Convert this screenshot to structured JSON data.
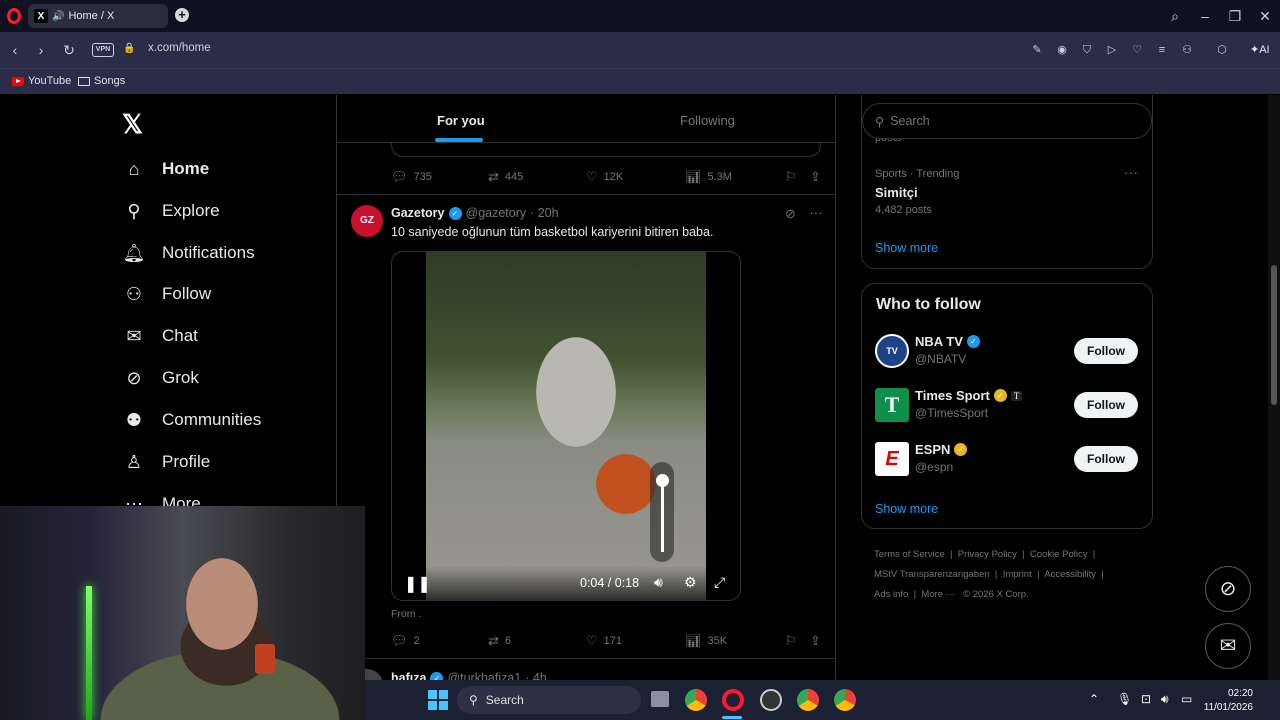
{
  "browser": {
    "tab_title": "Home / X",
    "url": "x.com/home",
    "vpn_label": "VPN",
    "ai_label": "AI",
    "bookmarks": [
      {
        "label": "YouTube",
        "icon": "youtube-icon"
      },
      {
        "label": "Songs",
        "icon": "folder-icon"
      }
    ]
  },
  "sidebar": {
    "items": [
      {
        "label": "Home",
        "icon": "home-icon",
        "active": true
      },
      {
        "label": "Explore",
        "icon": "search-icon"
      },
      {
        "label": "Notifications",
        "icon": "bell-icon"
      },
      {
        "label": "Follow",
        "icon": "person-add-icon"
      },
      {
        "label": "Chat",
        "icon": "mail-icon"
      },
      {
        "label": "Grok",
        "icon": "grok-icon"
      },
      {
        "label": "Communities",
        "icon": "communities-icon"
      },
      {
        "label": "Profile",
        "icon": "person-icon"
      },
      {
        "label": "More",
        "icon": "more-icon"
      }
    ]
  },
  "feed": {
    "tabs": [
      "For you",
      "Following"
    ],
    "prev_post_actions": {
      "replies": "735",
      "reposts": "445",
      "likes": "12K",
      "views": "5.3M"
    },
    "post": {
      "avatar_text": "GZ",
      "name": "Gazetory",
      "handle": "@gazetory",
      "time": "· 20h",
      "text": "10 saniyede oğlunun tüm basketbol kariyerini bitiren baba.",
      "video_time": "0:04 / 0:18",
      "volume_level": 1.0,
      "from_label": "From",
      "actions": {
        "replies": "2",
        "reposts": "6",
        "likes": "171",
        "views": "35K"
      }
    },
    "next_post": {
      "name": "hafıza",
      "handle": "@turkhafiza1",
      "time": "· 4h"
    }
  },
  "right": {
    "search_placeholder": "Search",
    "trend_partial": "posts",
    "trend": {
      "category": "Sports · Trending",
      "name": "Simitçi",
      "count": "4,482 posts"
    },
    "show_more": "Show more",
    "who_to_follow_title": "Who to follow",
    "accounts": [
      {
        "name": "NBA TV",
        "handle": "@NBATV",
        "badge": "blue",
        "avatar_color": "#1d428a"
      },
      {
        "name": "Times Sport",
        "handle": "@TimesSport",
        "badge": "gold",
        "avatar_color": "#0e8f4a",
        "affiliate": "T"
      },
      {
        "name": "ESPN",
        "handle": "@espn",
        "badge": "gold",
        "avatar_color": "#ffffff"
      }
    ],
    "follow_label": "Follow",
    "footer_links": [
      "Terms of Service",
      "Privacy Policy",
      "Cookie Policy",
      "MStV Transparenzangaben",
      "Imprint",
      "Accessibility",
      "Ads info",
      "More ···",
      "© 2026 X Corp."
    ]
  },
  "taskbar": {
    "search_label": "Search",
    "time": "02:20",
    "date": "11/01/2026"
  }
}
